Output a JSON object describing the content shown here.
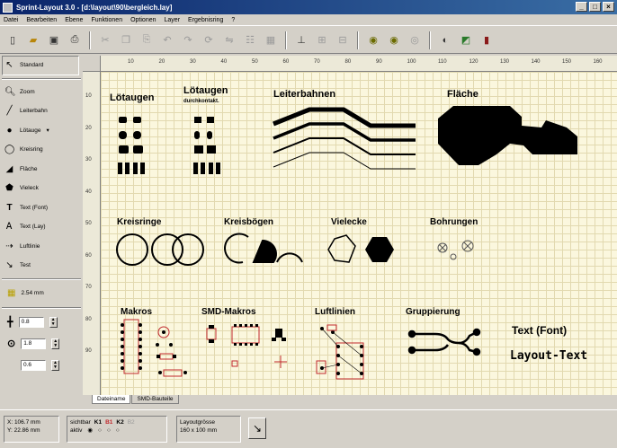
{
  "window": {
    "title": "Sprint-Layout 3.0 - [d:\\layout\\90\\bergleich.lay]",
    "buttons": [
      "_",
      "□",
      "×"
    ]
  },
  "menu": [
    "Datei",
    "Bearbeiten",
    "Ebene",
    "Funktionen",
    "Optionen",
    "Layer",
    "Ergebnisring",
    "?"
  ],
  "toolbar": {
    "icons": [
      "new-icon",
      "open-icon",
      "save-icon",
      "print-icon",
      "cut-icon",
      "copy-icon",
      "paste-icon",
      "undo-icon",
      "redo-icon",
      "rotate-icon",
      "mirror-icon",
      "align-icon",
      "group-icon",
      "ungroup-icon",
      "zoom-in-icon",
      "zoom-out-icon",
      "zoom-all-icon",
      "contrast-icon",
      "test-icon",
      "component-icon"
    ]
  },
  "left_tools": [
    {
      "icon": "cursor-icon",
      "label": "Standard",
      "selected": true
    },
    {
      "icon": "zoom-icon",
      "label": "Zoom"
    },
    {
      "icon": "track-icon",
      "label": "Leiterbahn"
    },
    {
      "icon": "pad-icon",
      "label": "Lötauge"
    },
    {
      "icon": "ring-icon",
      "label": "Kreisring"
    },
    {
      "icon": "area-icon",
      "label": "Fläche"
    },
    {
      "icon": "polygon-icon",
      "label": "Vieleck"
    },
    {
      "icon": "text-icon",
      "label": "Text (Font)"
    },
    {
      "icon": "text-layout-icon",
      "label": "Text (Lay)"
    },
    {
      "icon": "airwire-icon",
      "label": "Luftlinie"
    },
    {
      "icon": "test-probe-icon",
      "label": "Test"
    }
  ],
  "left_settings": {
    "grid": "2.54 mm",
    "track_width": "0.8",
    "pad_outer": "1.8",
    "pad_inner": "0.6"
  },
  "ruler": {
    "h": [
      "10",
      "20",
      "30",
      "40",
      "50",
      "60",
      "70",
      "80",
      "90",
      "100",
      "110",
      "120",
      "130",
      "140",
      "150",
      "160"
    ],
    "v": [
      "10",
      "20",
      "30",
      "40",
      "50",
      "60",
      "70",
      "80",
      "90"
    ]
  },
  "canvas_labels": {
    "loetaugen": "Lötaugen",
    "loetaugen_dk": "Lötaugen",
    "loetaugen_dk_sub": "durchkontakt.",
    "leiterbahnen": "Leiterbahnen",
    "flaeche": "Fläche",
    "kreisringe": "Kreisringe",
    "kreisboegen": "Kreisbögen",
    "vielecke": "Vielecke",
    "bohrungen": "Bohrungen",
    "makros": "Makros",
    "smd_makros": "SMD-Makros",
    "luftlinien": "Luftlinien",
    "gruppierung": "Gruppierung",
    "text_font": "Text (Font)",
    "layout_text": "Layout-Text"
  },
  "tabs": [
    "Dateiname",
    "SMD-Bauteile"
  ],
  "status": {
    "x": "X: 106.7 mm",
    "y": "Y: 22.86 mm",
    "sichtbar": "sichtbar",
    "aktiv": "aktiv",
    "layers": [
      "K1",
      "B1",
      "K2",
      "B2"
    ],
    "board_size_label": "Layoutgrösse",
    "board_size": "160 x 100 mm"
  },
  "colors": {
    "canvas": "#fbf7de",
    "grid": "#e2d9b0",
    "copper": "#000000",
    "red_component": "#c0282c"
  }
}
